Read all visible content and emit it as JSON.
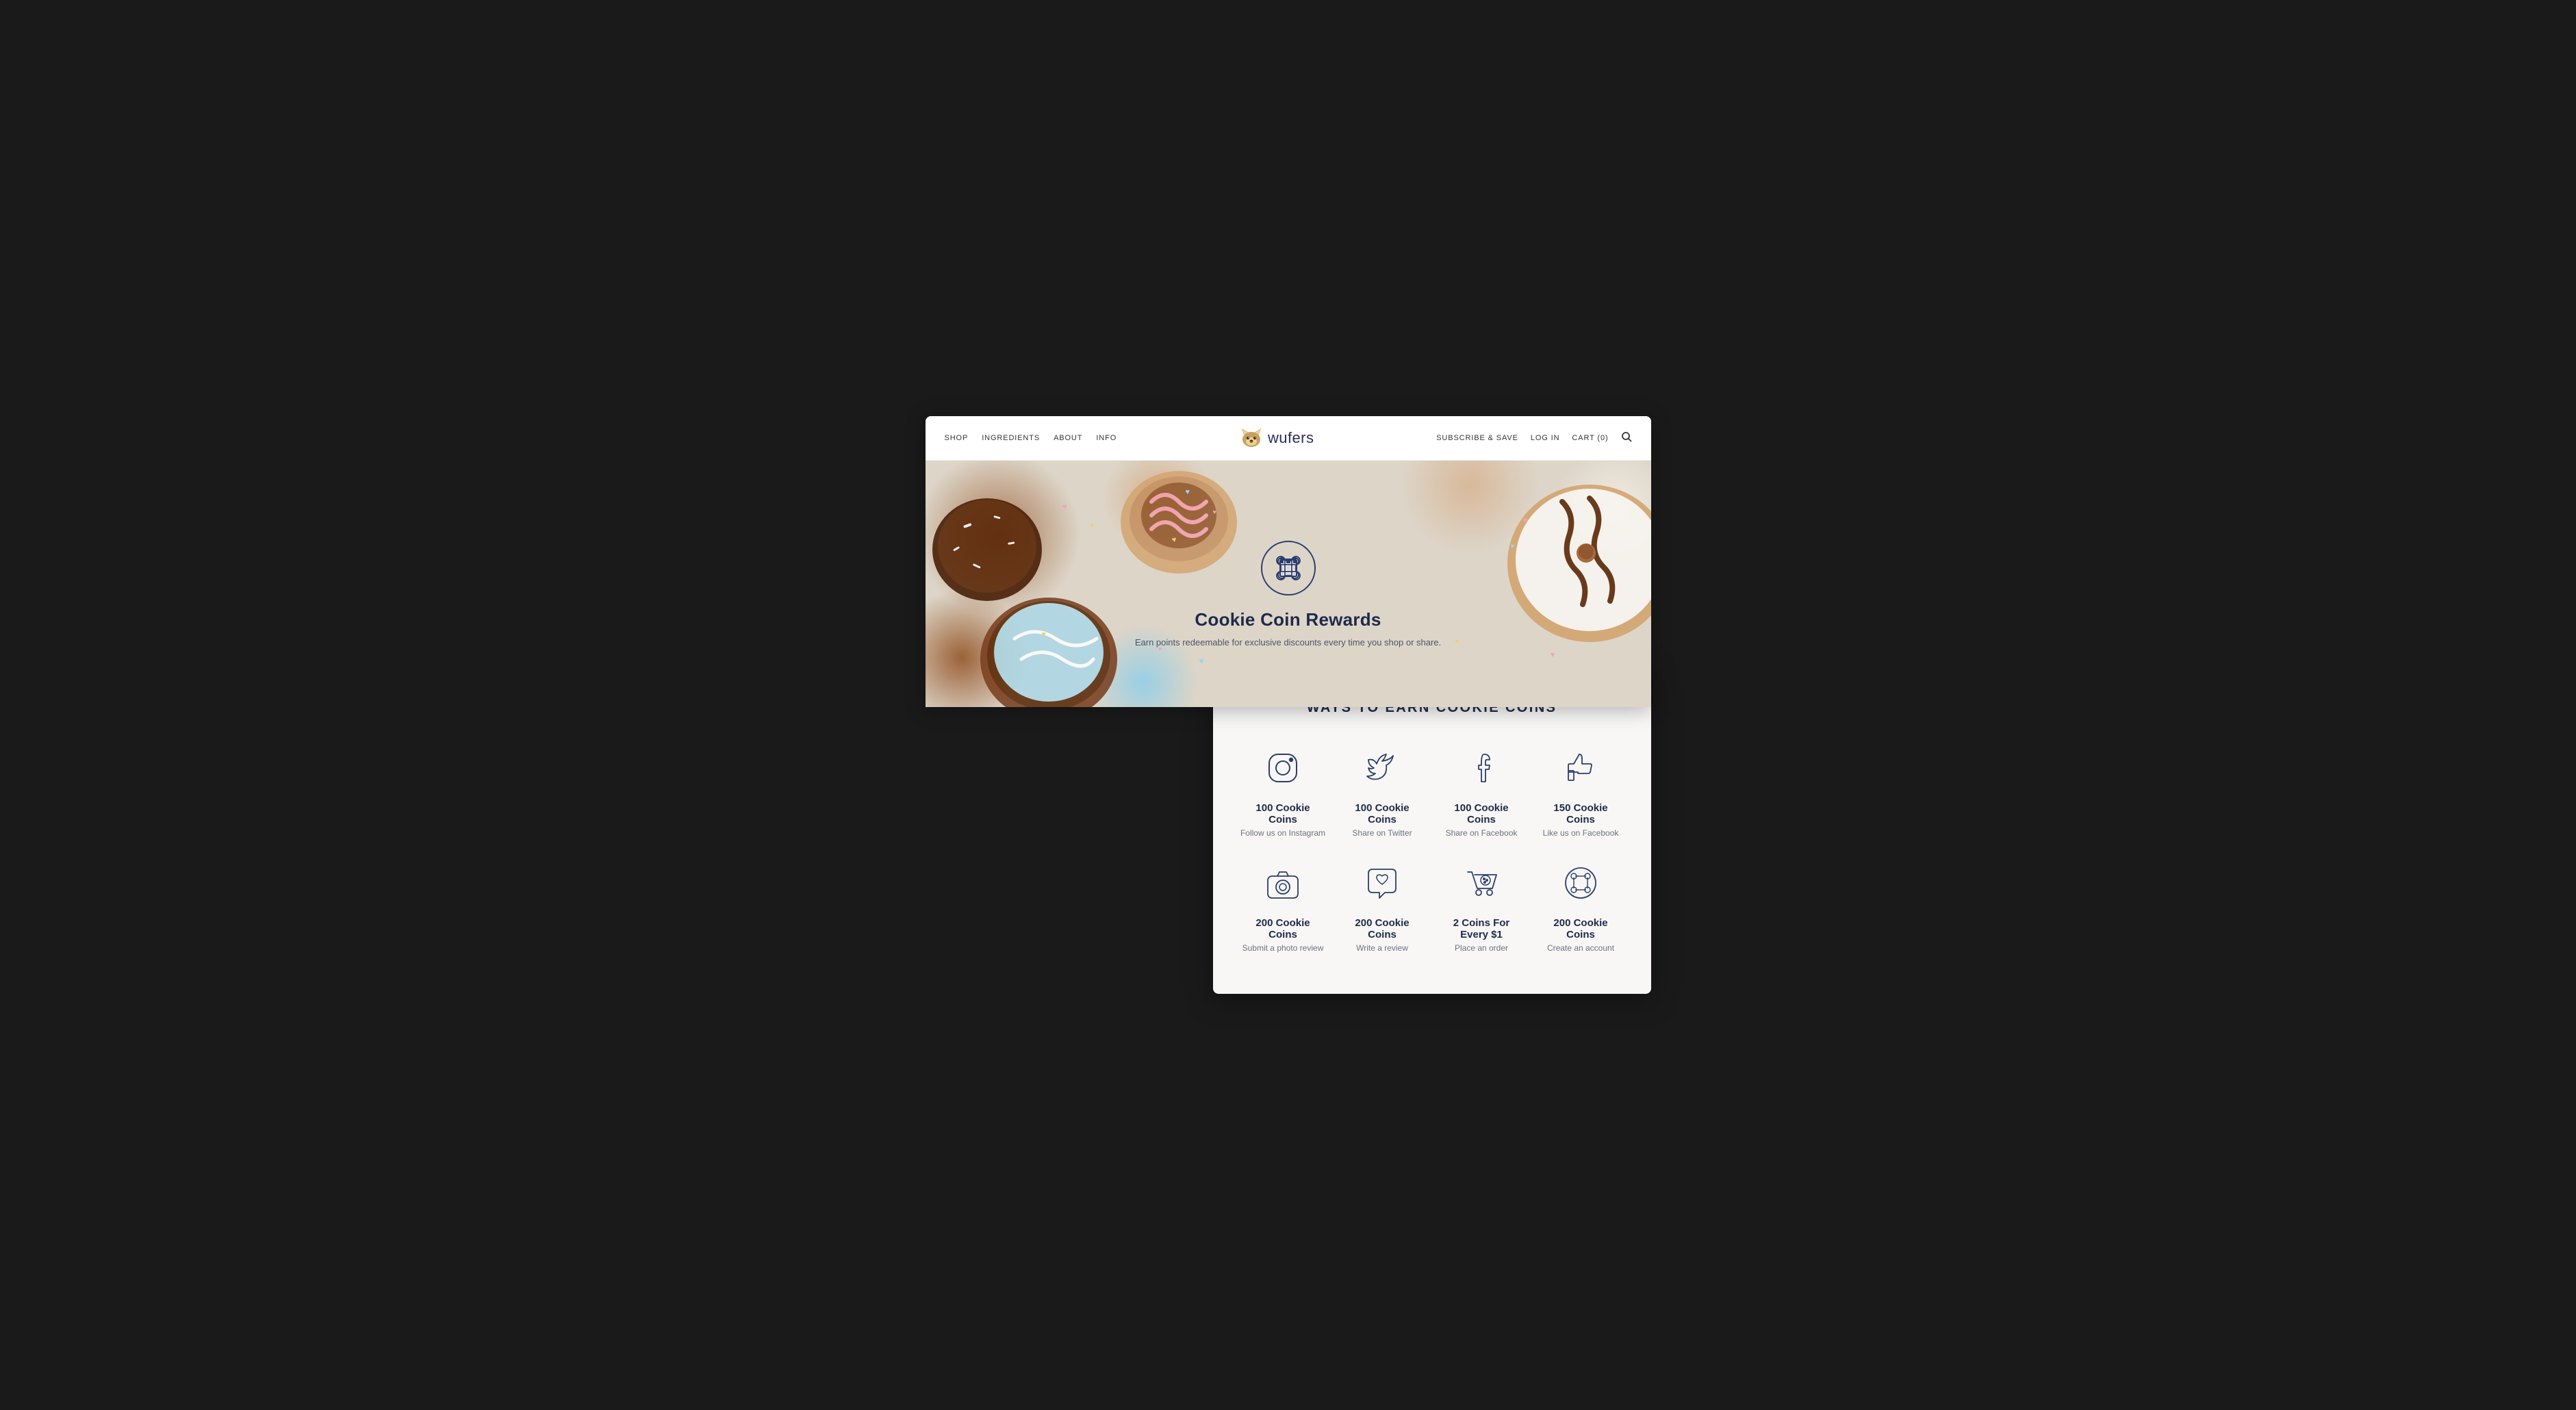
{
  "nav": {
    "links_left": [
      "SHOP",
      "INGREDIENTS",
      "ABOUT",
      "INFO"
    ],
    "brand": "wufers",
    "links_right": [
      "SUBSCRIBE & SAVE",
      "LOG IN",
      "CART (0)"
    ]
  },
  "hero": {
    "title": "Cookie Coin Rewards",
    "subtitle": "Earn points redeemable for exclusive discounts every time you shop or share."
  },
  "rewards": {
    "section_title": "WAYS TO EARN COOKIE COINS",
    "items": [
      {
        "id": "instagram",
        "coins": "100 Cookie Coins",
        "action": "Follow us on Instagram",
        "icon": "instagram"
      },
      {
        "id": "twitter",
        "coins": "100 Cookie Coins",
        "action": "Share on Twitter",
        "icon": "twitter"
      },
      {
        "id": "facebook-share",
        "coins": "100 Cookie Coins",
        "action": "Share on Facebook",
        "icon": "facebook"
      },
      {
        "id": "facebook-like",
        "coins": "150 Cookie Coins",
        "action": "Like us on Facebook",
        "icon": "thumbs-up"
      },
      {
        "id": "photo-review",
        "coins": "200 Cookie Coins",
        "action": "Submit a photo review",
        "icon": "camera"
      },
      {
        "id": "write-review",
        "coins": "200 Cookie Coins",
        "action": "Write a review",
        "icon": "heart-chat"
      },
      {
        "id": "place-order",
        "coins": "2 Coins For Every $1",
        "action": "Place an order",
        "icon": "cart"
      },
      {
        "id": "create-account",
        "coins": "200 Cookie Coins",
        "action": "Create an account",
        "icon": "cookie-coin"
      }
    ]
  }
}
